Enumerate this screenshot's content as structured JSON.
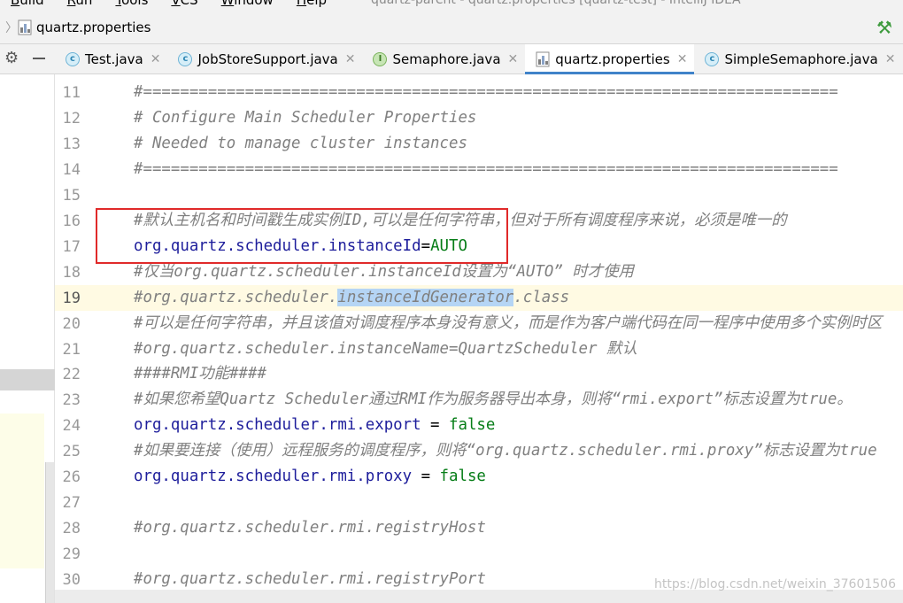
{
  "menubar": {
    "items": [
      "Build",
      "Run",
      "Tools",
      "VCS",
      "Window",
      "Help"
    ],
    "title": "quartz-parent - quartz.properties [quartz-test] - IntelliJ IDEA"
  },
  "breadcrumb": {
    "file": "quartz.properties"
  },
  "tabs": [
    {
      "label": "Test.java",
      "icon": "class-icon",
      "active": false
    },
    {
      "label": "JobStoreSupport.java",
      "icon": "class-icon",
      "active": false
    },
    {
      "label": "Semaphore.java",
      "icon": "interface-icon",
      "active": false
    },
    {
      "label": "quartz.properties",
      "icon": "properties-file-icon",
      "active": true
    },
    {
      "label": "SimpleSemaphore.java",
      "icon": "class-icon",
      "active": false
    }
  ],
  "editor": {
    "current_line": 19,
    "lines": [
      {
        "num": "11",
        "text": "#==========================================================================="
      },
      {
        "num": "12",
        "text": "# Configure Main Scheduler Properties"
      },
      {
        "num": "13",
        "text": "# Needed to manage cluster instances"
      },
      {
        "num": "14",
        "text": "#==========================================================================="
      },
      {
        "num": "15",
        "text": ""
      },
      {
        "num": "16",
        "text": "#默认主机名和时间戳生成实例ID,可以是任何字符串，但对于所有调度程序来说，必须是唯一的"
      },
      {
        "num": "17",
        "key": "org.quartz.scheduler.instanceId",
        "sep": "=",
        "value": "AUTO"
      },
      {
        "num": "18",
        "text": "#仅当org.quartz.scheduler.instanceId设置为“AUTO” 时才使用"
      },
      {
        "num": "19",
        "pre": "#org.quartz.scheduler.",
        "highlight": "instanceIdGenerator",
        "post": ".class"
      },
      {
        "num": "20",
        "text": "#可以是任何字符串，并且该值对调度程序本身没有意义，而是作为客户端代码在同一程序中使用多个实例时区"
      },
      {
        "num": "21",
        "text": "#org.quartz.scheduler.instanceName=QuartzScheduler 默认"
      },
      {
        "num": "22",
        "text": "####RMI功能####"
      },
      {
        "num": "23",
        "text": "#如果您希望Quartz Scheduler通过RMI作为服务器导出本身，则将“rmi.export”标志设置为true。"
      },
      {
        "num": "24",
        "key": "org.quartz.scheduler.rmi.export",
        "sep": " = ",
        "value": "false"
      },
      {
        "num": "25",
        "text": "#如果要连接（使用）远程服务的调度程序，则将“org.quartz.scheduler.rmi.proxy”标志设置为true"
      },
      {
        "num": "26",
        "key": "org.quartz.scheduler.rmi.proxy",
        "sep": " = ",
        "value": "false"
      },
      {
        "num": "27",
        "text": ""
      },
      {
        "num": "28",
        "text": "#org.quartz.scheduler.rmi.registryHost"
      },
      {
        "num": "29",
        "text": ""
      },
      {
        "num": "30",
        "text": "#org.quartz.scheduler.rmi.registryPort"
      }
    ]
  },
  "watermark": "https://blog.csdn.net/weixin_37601506",
  "colors": {
    "comment": "#808080",
    "key": "#1d1d9b",
    "value": "#067d17",
    "annotation_box": "#e02a2a",
    "selection": "#b5d5f5",
    "active_tab_underline": "#4083c9"
  }
}
